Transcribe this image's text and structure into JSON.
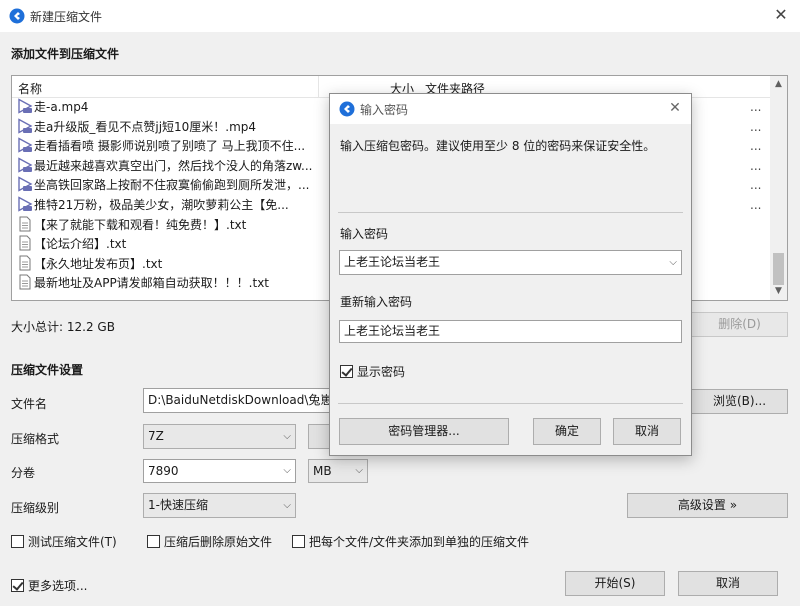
{
  "window": {
    "title": "新建压缩文件",
    "close_glyph": "✕"
  },
  "add_section": {
    "heading": "添加文件到压缩文件"
  },
  "file_list": {
    "columns": {
      "name": "名称",
      "size": "大小",
      "path": "文件夹路径"
    },
    "items": [
      {
        "name": "走-a.mp4",
        "type": "video"
      },
      {
        "name": "走a升级版_看见不点赞jj短10厘米！.mp4",
        "type": "video"
      },
      {
        "name": "走看插看喷 摄影师说别喷了别喷了 马上我顶不住...",
        "type": "video"
      },
      {
        "name": "最近越来越喜欢真空出门，然后找个没人的角落zw...",
        "type": "video"
      },
      {
        "name": "坐高铁回家路上按耐不住寂寞偷偷跑到厕所发泄，...",
        "type": "video"
      },
      {
        "name": "推特21万粉，极品美少女，潮吹萝莉公主【免...",
        "type": "video"
      },
      {
        "name": "【来了就能下载和观看！纯免费！】.txt",
        "type": "text"
      },
      {
        "name": "【论坛介绍】.txt",
        "type": "text"
      },
      {
        "name": "【永久地址发布页】.txt",
        "type": "text"
      },
      {
        "name": "最新地址及APP请发邮箱自动获取！！！.txt",
        "type": "text"
      }
    ],
    "right_edge_fragments": [
      "...",
      "...",
      "...",
      "...",
      "...",
      "..."
    ],
    "scroll_up": "▲",
    "scroll_down": "▼"
  },
  "total_size": "大小总计: 12.2 GB",
  "delete_button": "删除(D)",
  "archive_section": {
    "heading": "压缩文件设置"
  },
  "filename": {
    "label": "文件名",
    "value": "D:\\BaiduNetdiskDownload\\兔崽"
  },
  "browse_button": "浏览(B)...",
  "format": {
    "label": "压缩格式",
    "value": "7Z"
  },
  "split": {
    "label": "分卷",
    "value": "7890",
    "unit": "MB"
  },
  "level": {
    "label": "压缩级别",
    "value": "1-快速压缩"
  },
  "advanced_button": "高级设置 »",
  "options": {
    "test": {
      "label": "测试压缩文件(T)",
      "checked": false
    },
    "delete_original": {
      "label": "压缩后删除原始文件",
      "checked": false
    },
    "separate": {
      "label": "把每个文件/文件夹添加到单独的压缩文件",
      "checked": false
    }
  },
  "more_options": {
    "label": "更多选项...",
    "checked": true
  },
  "start_button": "开始(S)",
  "cancel_button": "取消",
  "password_dialog": {
    "title": "输入密码",
    "close_glyph": "✕",
    "hint": "输入压缩包密码。建议使用至少 8 位的密码来保证安全性。",
    "password_label": "输入密码",
    "password_value": "上老王论坛当老王",
    "confirm_label": "重新输入密码",
    "confirm_value": "上老王论坛当老王",
    "show_password": {
      "label": "显示密码",
      "checked": true
    },
    "manager_button": "密码管理器...",
    "ok_button": "确定",
    "cancel_button": "取消"
  },
  "colors": {
    "accent": "#1e6fd9",
    "window_bg": "#f0f0f0",
    "border": "#a0a0a0"
  },
  "icons": {
    "app": "app-logo-icon",
    "video": "video-file-icon",
    "text": "text-file-icon",
    "dropdown": "chevron-down-icon"
  }
}
